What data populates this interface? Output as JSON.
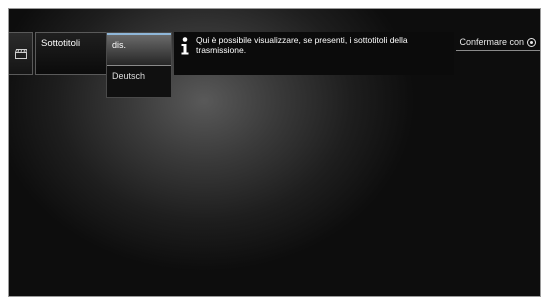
{
  "menu": {
    "title": "Sottotitoli"
  },
  "options": {
    "items": [
      {
        "label": "dis.",
        "selected": true
      },
      {
        "label": "Deutsch",
        "selected": false
      }
    ]
  },
  "info": {
    "icon": "info-icon",
    "text": "Qui è possibile visualizzare, se presenti, i sottotitoli della trasmissione."
  },
  "hint": {
    "confirm_label": "Confermare con",
    "icon": "ok-button-icon"
  },
  "colors": {
    "selection_accent": "#8fb7d9"
  }
}
